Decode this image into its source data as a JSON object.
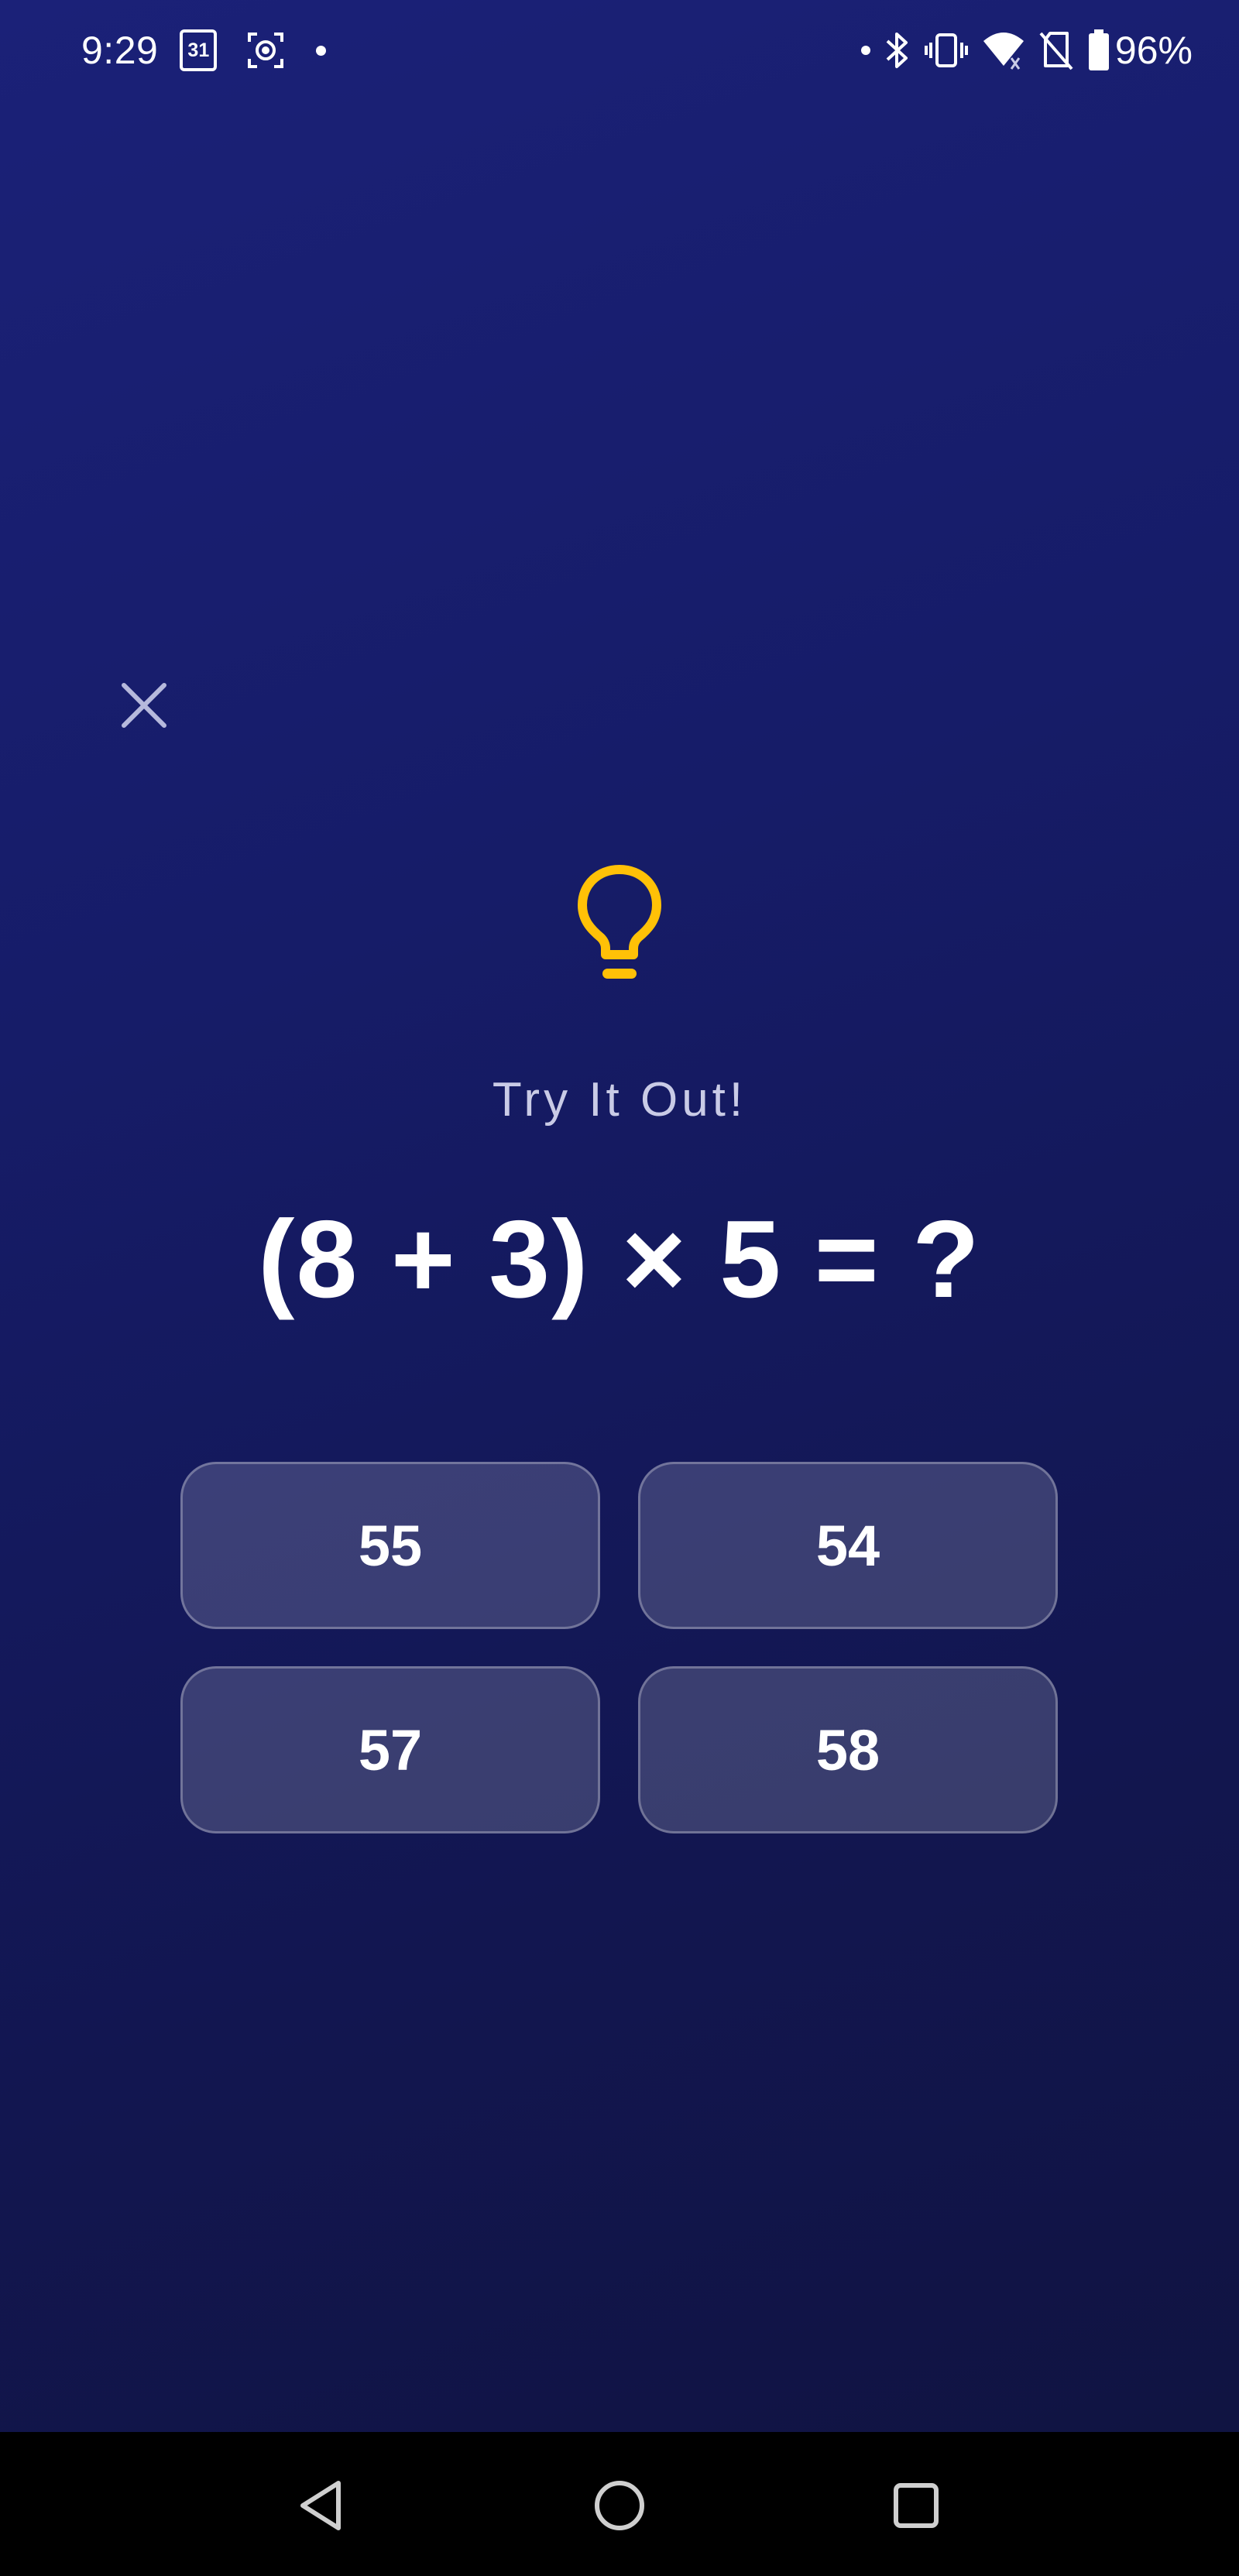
{
  "status_bar": {
    "time": "9:29",
    "calendar_day": "31",
    "battery_percent": "96%"
  },
  "dialog": {
    "close_icon": "close-icon",
    "hint_icon": "lightbulb-icon",
    "hint_icon_color": "#FFC107",
    "subtitle": "Try It Out!",
    "equation": "(8 + 3) × 5 = ?",
    "answers": [
      "55",
      "54",
      "57",
      "58"
    ]
  },
  "nav_bar": {
    "icons": [
      "back-icon",
      "home-icon",
      "recents-icon"
    ]
  },
  "colors": {
    "background_top": "#1b2178",
    "background_bottom": "#10133f",
    "answer_button_fill": "rgba(255,255,255,0.17)",
    "subtitle_text": "#c9cbe6"
  }
}
